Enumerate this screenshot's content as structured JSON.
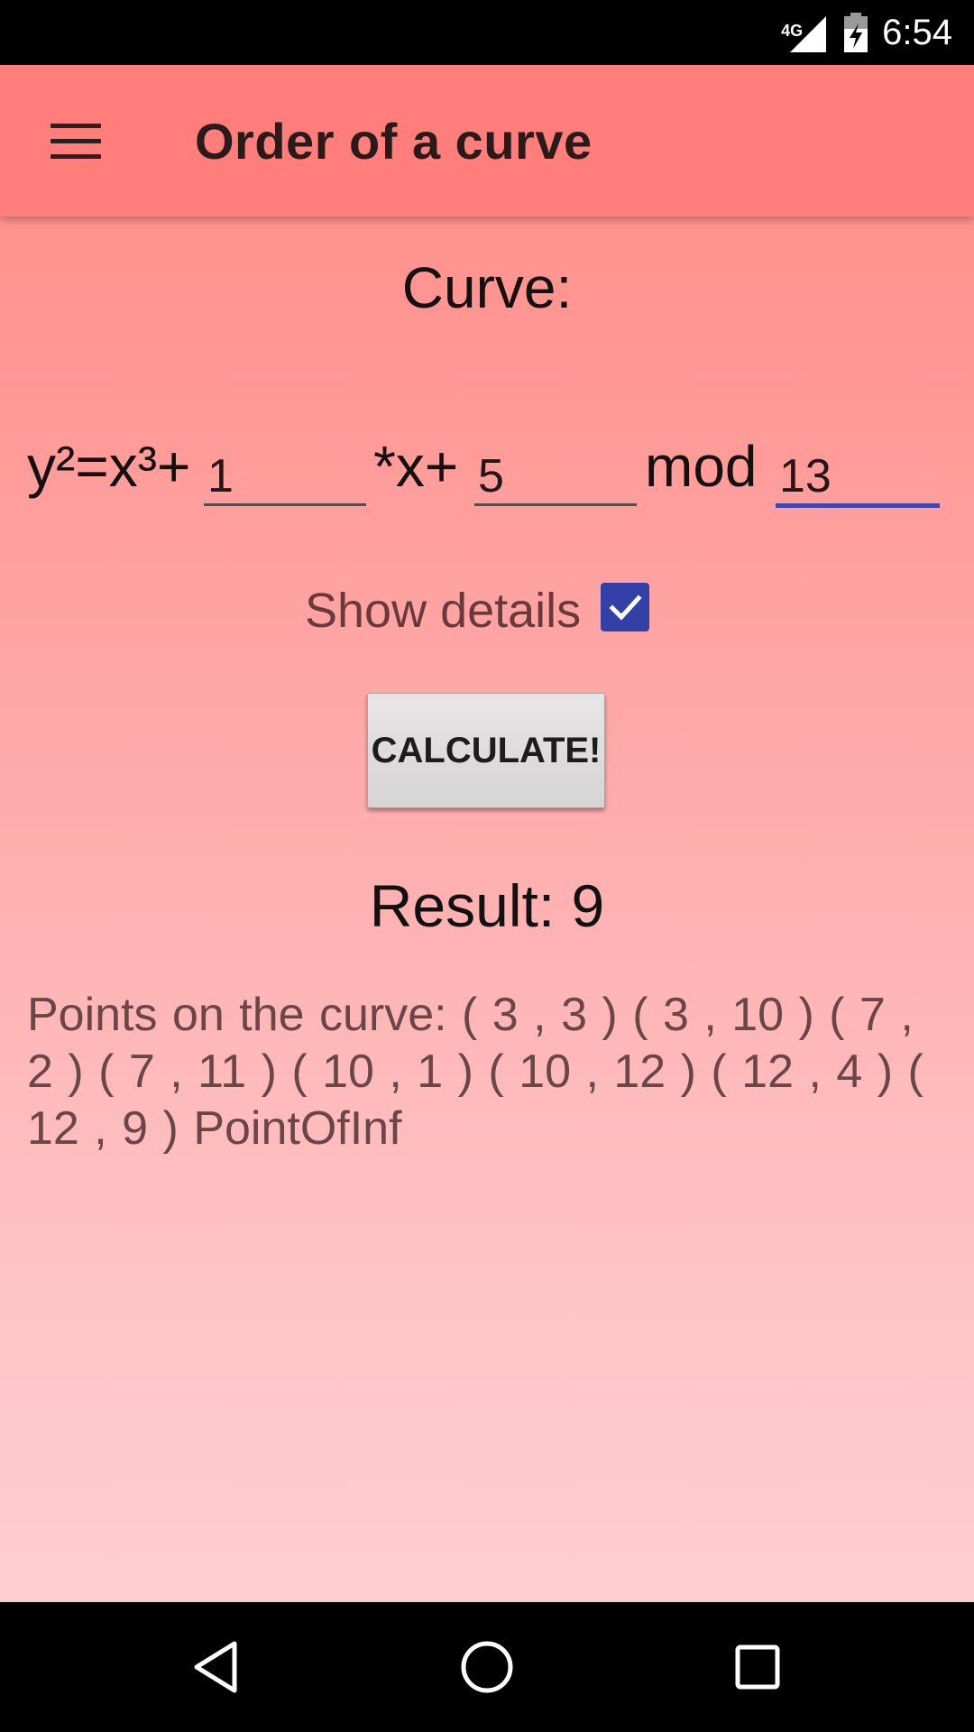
{
  "status_bar": {
    "network_type": "4G",
    "time": "6:54",
    "icons": [
      "signal-icon",
      "battery-charging-icon"
    ]
  },
  "toolbar": {
    "menu_icon": "hamburger-menu-icon",
    "title": "Order of a curve"
  },
  "form": {
    "curve_label": "Curve:",
    "equation_prefix": "y²=x³+",
    "coefficient_a": "1",
    "x_term_label": "*x+",
    "coefficient_b": "5",
    "mod_label": "mod",
    "modulus": "13",
    "show_details_label": "Show details",
    "show_details_checked": true,
    "calculate_label": "CALCULATE!"
  },
  "output": {
    "result_text": "Result: 9",
    "points_text": "Points on the curve: ( 3 , 3 )  ( 3 , 10 )  ( 7 , 2 )  ( 7 , 11 )  ( 10 , 1 )  ( 10 , 12 )  ( 12 , 4 )  ( 12 , 9 )  PointOfInf"
  },
  "nav_bar": {
    "icons": [
      "back-icon",
      "home-icon",
      "recents-icon"
    ]
  },
  "colors": {
    "toolbar": "#ff7d7a",
    "accent": "#3f44b0",
    "checkbox": "#3340a8",
    "background_top": "#ff8a85",
    "background_bottom": "#ffcdd0"
  }
}
